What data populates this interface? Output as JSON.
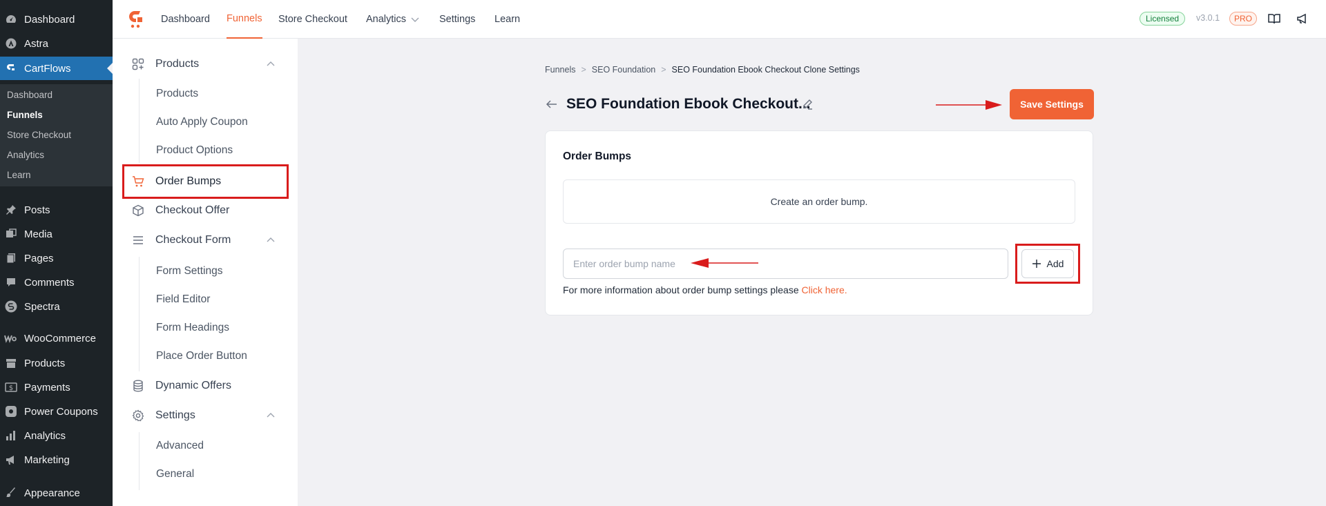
{
  "wp_menu": {
    "items": [
      {
        "label": "Dashboard",
        "icon": "dashboard-icon"
      },
      {
        "label": "Astra",
        "icon": "astra-icon"
      },
      {
        "label": "CartFlows",
        "icon": "cartflows-icon"
      },
      {
        "label": "Posts",
        "icon": "pin-icon"
      },
      {
        "label": "Media",
        "icon": "media-icon"
      },
      {
        "label": "Pages",
        "icon": "pages-icon"
      },
      {
        "label": "Comments",
        "icon": "comment-icon"
      },
      {
        "label": "Spectra",
        "icon": "spectra-icon"
      },
      {
        "label": "WooCommerce",
        "icon": "woocommerce-icon"
      },
      {
        "label": "Products",
        "icon": "archive-icon"
      },
      {
        "label": "Payments",
        "icon": "payments-icon"
      },
      {
        "label": "Power Coupons",
        "icon": "coupon-icon"
      },
      {
        "label": "Analytics",
        "icon": "bar-chart-icon"
      },
      {
        "label": "Marketing",
        "icon": "megaphone-icon"
      },
      {
        "label": "Appearance",
        "icon": "brush-icon"
      }
    ],
    "submenu": [
      "Dashboard",
      "Funnels",
      "Store Checkout",
      "Analytics",
      "Learn"
    ]
  },
  "topnav": {
    "items": [
      "Dashboard",
      "Funnels",
      "Store Checkout",
      "Analytics",
      "Settings",
      "Learn"
    ],
    "licensed": "Licensed",
    "version": "v3.0.1",
    "pro": "PRO"
  },
  "settings_nav": {
    "products": {
      "label": "Products",
      "children": [
        "Products",
        "Auto Apply Coupon",
        "Product Options"
      ]
    },
    "order_bumps": "Order Bumps",
    "checkout_offer": "Checkout Offer",
    "checkout_form": {
      "label": "Checkout Form",
      "children": [
        "Form Settings",
        "Field Editor",
        "Form Headings",
        "Place Order Button"
      ]
    },
    "dynamic_offers": "Dynamic Offers",
    "settings": {
      "label": "Settings",
      "children": [
        "Advanced",
        "General"
      ]
    }
  },
  "breadcrumb": [
    "Funnels",
    "SEO Foundation",
    "SEO Foundation Ebook Checkout Clone Settings"
  ],
  "breadcrumb_sep": ">",
  "page": {
    "title": "SEO Foundation Ebook Checkout...",
    "save_label": "Save Settings"
  },
  "order_bumps": {
    "heading": "Order Bumps",
    "empty": "Create an order bump.",
    "input_placeholder": "Enter order bump name",
    "add_label": "Add",
    "info_text": "For more information about order bump settings please ",
    "info_link": "Click here."
  },
  "colors": {
    "accent": "#f06335",
    "highlight": "#d91c1c",
    "wp_active": "#2271b1"
  }
}
